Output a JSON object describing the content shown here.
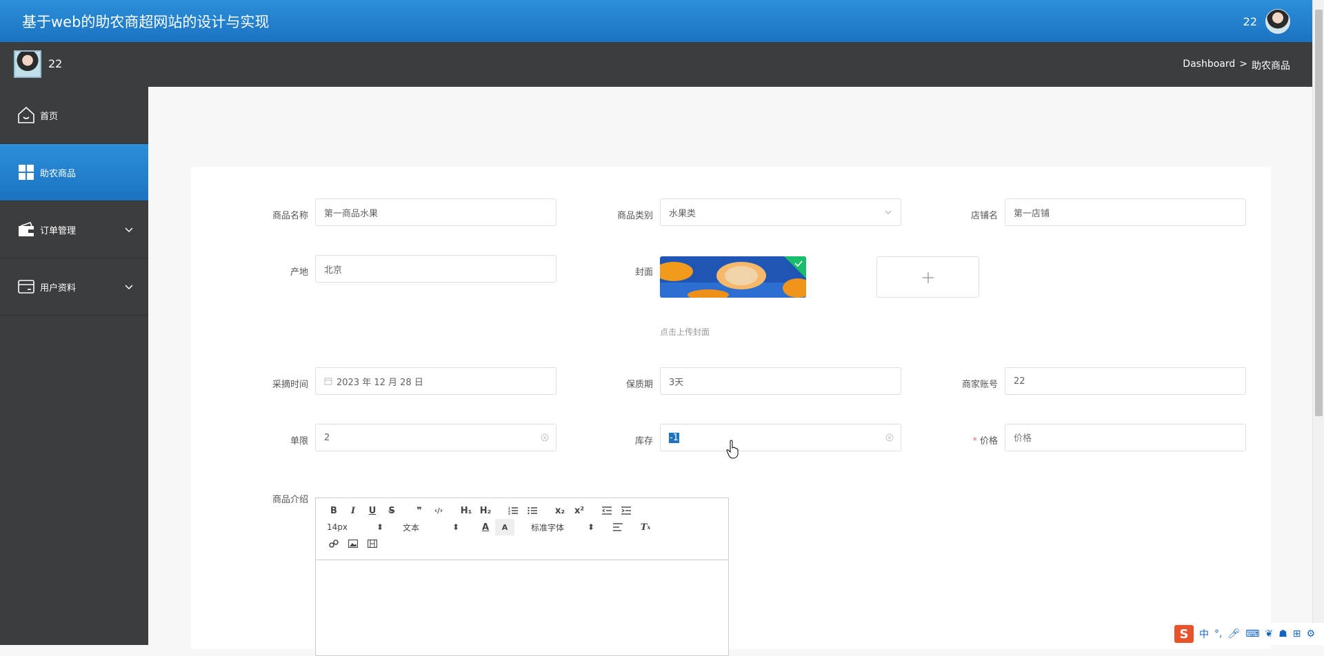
{
  "header": {
    "title": "基于web的助农商超网站的设计与实现",
    "user": "22"
  },
  "subbar": {
    "username": "22",
    "breadcrumb": {
      "home": "Dashboard",
      "sep": ">",
      "current": "助农商品"
    }
  },
  "sidebar": {
    "items": [
      {
        "label": "首页",
        "icon": "home-icon",
        "active": false,
        "expandable": false
      },
      {
        "label": "助农商品",
        "icon": "grid-icon",
        "active": true,
        "expandable": false
      },
      {
        "label": "订单管理",
        "icon": "wallet-icon",
        "active": false,
        "expandable": true
      },
      {
        "label": "用户资料",
        "icon": "card-icon",
        "active": false,
        "expandable": true
      }
    ]
  },
  "form": {
    "name": {
      "label": "商品名称",
      "value": "第一商品水果"
    },
    "category": {
      "label": "商品类别",
      "value": "水果类"
    },
    "shop": {
      "label": "店铺名",
      "value": "第一店铺"
    },
    "origin": {
      "label": "产地",
      "value": "北京"
    },
    "cover": {
      "label": "封面",
      "hint": "点击上传封面",
      "plus": "+"
    },
    "pickdate": {
      "label": "采摘时间",
      "value": "2023 年 12 月 28 日"
    },
    "shelf": {
      "label": "保质期",
      "value": "3天"
    },
    "merchant": {
      "label": "商家账号",
      "value": "22"
    },
    "limit": {
      "label": "单限",
      "value": "2"
    },
    "stock": {
      "label": "库存",
      "value": "-1"
    },
    "price": {
      "label": "价格",
      "placeholder": "价格",
      "required_mark": "*"
    },
    "intro": {
      "label": "商品介绍"
    }
  },
  "editor": {
    "row1": [
      "B",
      "I",
      "U",
      "S",
      "❞",
      "‹/›",
      "H₁",
      "H₂",
      "ol",
      "ul",
      "x₂",
      "x²",
      "outdent",
      "indent"
    ],
    "size": "14px",
    "header": "文本",
    "font": "标准字体"
  },
  "ime": {
    "lang": "中"
  },
  "colors": {
    "accent": "#1b73c2",
    "sidebar": "#3c3d3f",
    "required": "#f56c6c"
  }
}
